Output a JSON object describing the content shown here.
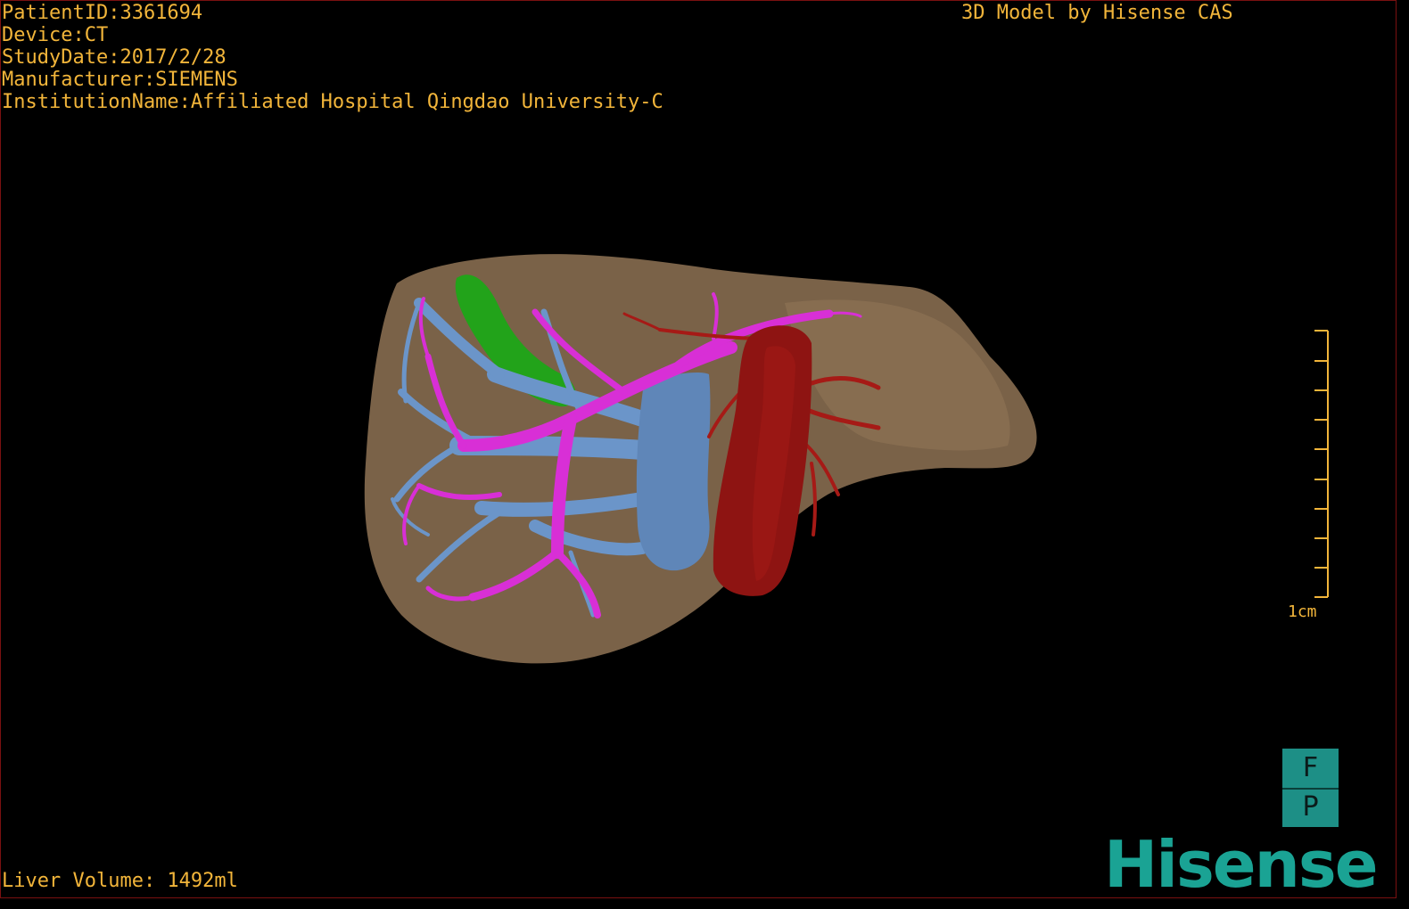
{
  "info": {
    "patient_id": "PatientID:3361694",
    "device": "Device:CT",
    "study_date": "StudyDate:2017/2/28",
    "manufacturer": "Manufacturer:SIEMENS",
    "institution": "InstitutionName:Affiliated Hospital Qingdao University-C"
  },
  "credit": "3D Model by Hisense CAS",
  "liver_volume": "Liver Volume: 1492ml",
  "scale_bar": {
    "label": "1cm"
  },
  "orientation": {
    "top": "F",
    "bottom": "P"
  },
  "logo": "Hisense",
  "colors": {
    "text": "#f2b53a",
    "liver": "#7a6248",
    "portal_vein": "#d82fd6",
    "hepatic_vein": "#6b95c9",
    "artery": "#8e1412",
    "gallbladder": "#22a31a",
    "logo": "#1aa394"
  }
}
